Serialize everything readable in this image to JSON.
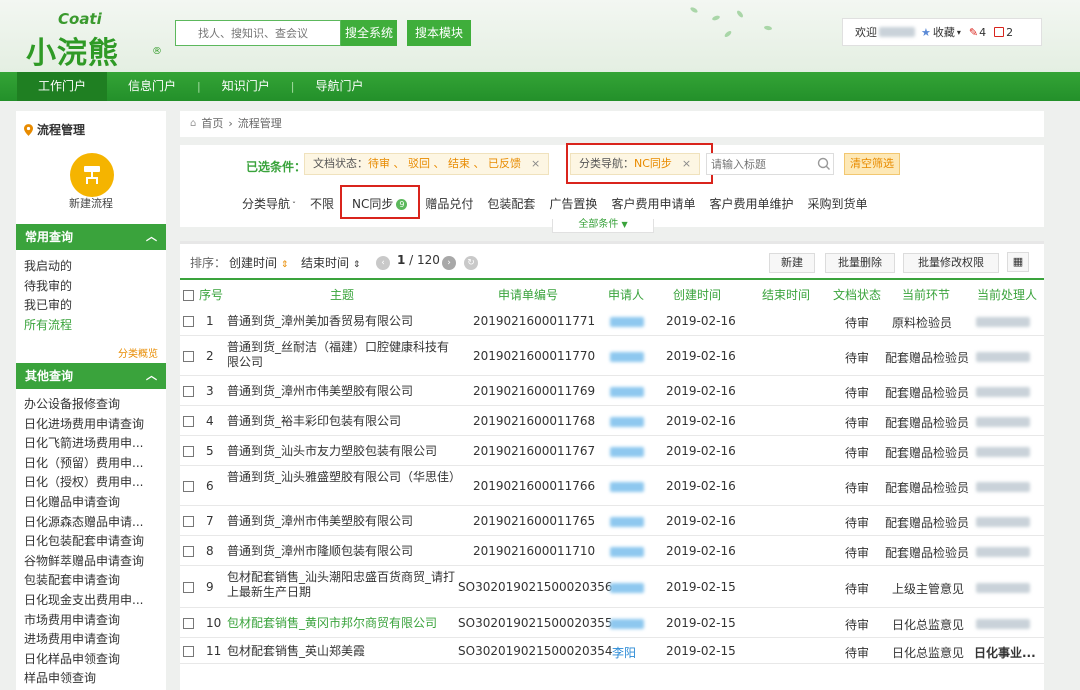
{
  "header": {
    "logo_en": "Coati",
    "logo_cn": "小浣熊",
    "logo_mark": "®",
    "search_placeholder": "找人、搜知识、查会议",
    "search_all_label": "搜全系统",
    "search_module_label": "搜本模块",
    "welcome": "欢迎",
    "favorites_label": "收藏",
    "pen_count": "4",
    "msg_count": "2"
  },
  "nav": {
    "items": [
      "工作门户",
      "信息门户",
      "知识门户",
      "导航门户"
    ]
  },
  "sidebar": {
    "title": "流程管理",
    "new_flow_label": "新建流程",
    "common_title": "常用查询",
    "common_items": [
      "我启动的",
      "待我审的",
      "我已审的",
      "所有流程"
    ],
    "common_more": "分类概览",
    "other_title": "其他查询",
    "other_items": [
      "办公设备报修查询",
      "日化进场费用申请查询",
      "日化飞箭进场费用申...",
      "日化（预留）费用申...",
      "日化（授权）费用申...",
      "日化赠品申请查询",
      "日化源森态赠品申请...",
      "日化包装配套申请查询",
      "谷物鲜萃赠品申请查询",
      "包装配套申请查询",
      "日化现金支出费用申...",
      "市场费用申请查询",
      "进场费用申请查询",
      "日化样品申领查询",
      "样品申领查询"
    ]
  },
  "breadcrumb": {
    "home": "首页",
    "current": "流程管理"
  },
  "filter": {
    "selected_label": "已选条件：",
    "status_key": "文档状态：",
    "status_value": "待审 、 驳回 、 结束 、 已反馈",
    "nav_key": "分类导航：",
    "nav_value": "NC同步",
    "close_glyph": "×",
    "title_placeholder": "请输入标题",
    "clear_label": "清空筛选",
    "category_label": "分类导航",
    "categories": [
      "不限",
      "NC同步",
      "赠品兑付",
      "包装配套",
      "广告置换",
      "客户费用申请单",
      "客户费用单维护",
      "采购到货单"
    ],
    "nc_badge": "9",
    "all_conditions": "全部条件"
  },
  "toolbar": {
    "sort_label": "排序：",
    "sort_create": "创建时间",
    "sort_end": "结束时间",
    "page_current": "1",
    "page_total": "120",
    "new_label": "新建",
    "batch_delete_label": "批量删除",
    "batch_perm_label": "批量修改权限"
  },
  "table": {
    "columns": [
      "序号",
      "主题",
      "申请单编号",
      "申请人",
      "创建时间",
      "结束时间",
      "文档状态",
      "当前环节",
      "当前处理人"
    ],
    "rows": [
      {
        "no": "1",
        "subject": "普通到货_漳州美加香贸易有限公司",
        "code": "2019021600011771",
        "applicant": "",
        "created": "2019-02-16",
        "ended": "",
        "status": "待审",
        "step": "原料检验员",
        "handler": ""
      },
      {
        "no": "2",
        "subject": "普通到货_丝耐洁（福建）口腔健康科技有限公司",
        "code": "2019021600011770",
        "applicant": "",
        "created": "2019-02-16",
        "ended": "",
        "status": "待审",
        "step": "配套赠品检验员",
        "handler": ""
      },
      {
        "no": "3",
        "subject": "普通到货_漳州市伟美塑胶有限公司",
        "code": "2019021600011769",
        "applicant": "",
        "created": "2019-02-16",
        "ended": "",
        "status": "待审",
        "step": "配套赠品检验员",
        "handler": ""
      },
      {
        "no": "4",
        "subject": "普通到货_裕丰彩印包装有限公司",
        "code": "2019021600011768",
        "applicant": "",
        "created": "2019-02-16",
        "ended": "",
        "status": "待审",
        "step": "配套赠品检验员",
        "handler": ""
      },
      {
        "no": "5",
        "subject": "普通到货_汕头市友力塑胶包装有限公司",
        "code": "2019021600011767",
        "applicant": "",
        "created": "2019-02-16",
        "ended": "",
        "status": "待审",
        "step": "配套赠品检验员",
        "handler": ""
      },
      {
        "no": "6",
        "subject": "普通到货_汕头雅盛塑胶有限公司（华思佳）",
        "code": "2019021600011766",
        "applicant": "",
        "created": "2019-02-16",
        "ended": "",
        "status": "待审",
        "step": "配套赠品检验员",
        "handler": ""
      },
      {
        "no": "7",
        "subject": "普通到货_漳州市伟美塑胶有限公司",
        "code": "2019021600011765",
        "applicant": "",
        "created": "2019-02-16",
        "ended": "",
        "status": "待审",
        "step": "配套赠品检验员",
        "handler": ""
      },
      {
        "no": "8",
        "subject": "普通到货_漳州市隆顺包装有限公司",
        "code": "2019021600011710",
        "applicant": "",
        "created": "2019-02-16",
        "ended": "",
        "status": "待审",
        "step": "配套赠品检验员",
        "handler": ""
      },
      {
        "no": "9",
        "subject": "包材配套销售_汕头潮阳忠盛百货商贸_请打上最新生产日期",
        "code": "SO302019021500020356",
        "applicant": "",
        "created": "2019-02-15",
        "ended": "",
        "status": "待审",
        "step": "上级主管意见",
        "handler": ""
      },
      {
        "no": "10",
        "subject": "包材配套销售_黄冈市邦尔商贸有限公司",
        "code": "SO302019021500020355",
        "applicant": "",
        "created": "2019-02-15",
        "ended": "",
        "status": "待审",
        "step": "日化总监意见",
        "handler": ""
      },
      {
        "no": "11",
        "subject": "包材配套销售_英山郑美霞",
        "code": "SO302019021500020354",
        "applicant": "李阳",
        "created": "2019-02-15",
        "ended": "",
        "status": "待审",
        "step": "日化总监意见",
        "handler": "日化事业..."
      }
    ]
  },
  "colors": {
    "brand_green": "#3aa33c",
    "accent_orange": "#e88b00",
    "highlight_red": "#d9241c"
  }
}
